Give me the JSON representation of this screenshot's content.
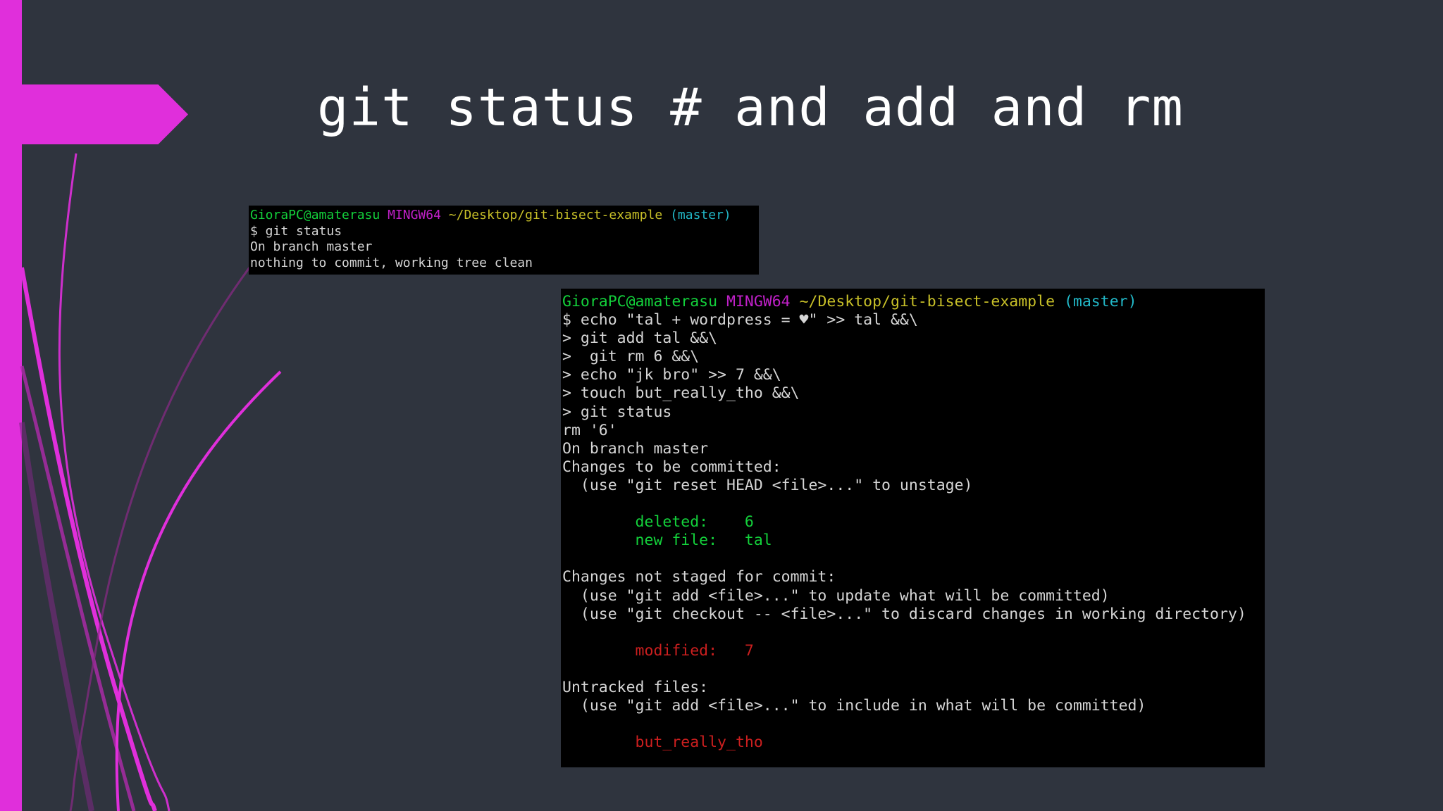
{
  "slide": {
    "title": "git status # and add and rm",
    "accent_color": "#e02fdb",
    "background_color": "#2f343e"
  },
  "terminal_small": {
    "prompt": {
      "user_host": "GioraPC@amaterasu",
      "shell": "MINGW64",
      "path": "~/Desktop/git-bisect-example",
      "branch": "(master)"
    },
    "lines": [
      "$ git status",
      "On branch master",
      "nothing to commit, working tree clean"
    ]
  },
  "terminal_large": {
    "prompt": {
      "user_host": "GioraPC@amaterasu",
      "shell": "MINGW64",
      "path": "~/Desktop/git-bisect-example",
      "branch": "(master)"
    },
    "commands": [
      "$ echo \"tal + wordpress = ♥\" >> tal &&\\",
      "> git add tal &&\\",
      ">  git rm 6 &&\\",
      "> echo \"jk bro\" >> 7 &&\\",
      "> touch but_really_tho &&\\",
      "> git status"
    ],
    "output_head": [
      "rm '6'",
      "On branch master",
      "Changes to be committed:",
      "  (use \"git reset HEAD <file>...\" to unstage)"
    ],
    "staged": [
      "        deleted:    6",
      "        new file:   tal"
    ],
    "not_staged_header": [
      "Changes not staged for commit:",
      "  (use \"git add <file>...\" to update what will be committed)",
      "  (use \"git checkout -- <file>...\" to discard changes in working directory)"
    ],
    "modified": "        modified:   7",
    "untracked_header": [
      "Untracked files:",
      "  (use \"git add <file>...\" to include in what will be committed)"
    ],
    "untracked": "        but_really_tho"
  }
}
